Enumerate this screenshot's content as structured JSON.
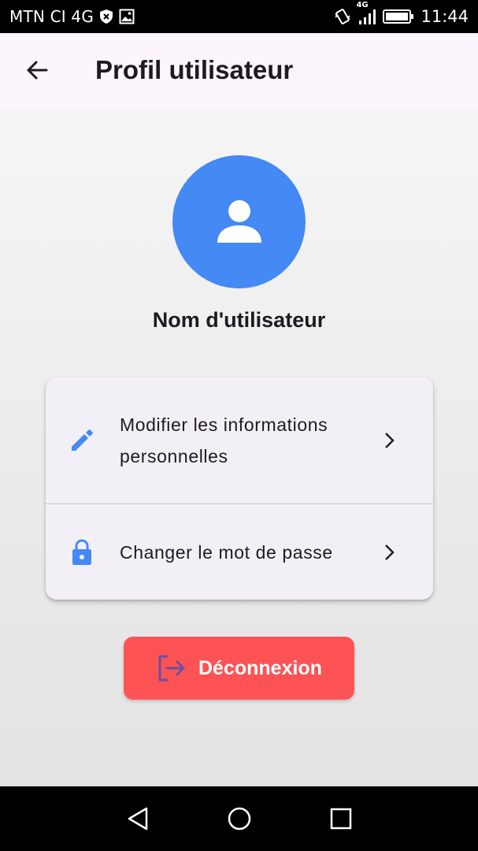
{
  "status_bar": {
    "carrier": "MTN CI 4G",
    "network_label": "4G",
    "time": "11:44",
    "icons": [
      "shield-x-icon",
      "image-icon",
      "vibrate-icon",
      "signal-icon",
      "battery-icon"
    ]
  },
  "app_bar": {
    "back_icon": "arrow-left-icon",
    "title": "Profil utilisateur"
  },
  "profile": {
    "avatar_icon": "person-icon",
    "username": "Nom d'utilisateur"
  },
  "menu": {
    "items": [
      {
        "icon": "pencil-icon",
        "label": "Modifier les informations personnelles",
        "trailing_icon": "chevron-right-icon"
      },
      {
        "icon": "lock-icon",
        "label": "Changer le mot de passe",
        "trailing_icon": "chevron-right-icon"
      }
    ]
  },
  "logout": {
    "icon": "logout-icon",
    "label": "Déconnexion"
  },
  "nav_bar": {
    "buttons": [
      "back-triangle-icon",
      "home-circle-icon",
      "recents-square-icon"
    ]
  },
  "colors": {
    "primary_blue": "#4489f4",
    "logout_red": "#fd5355",
    "logout_icon_purple": "#6750a4",
    "app_bar_bg": "#fcf5fd",
    "card_bg": "#f3eff6",
    "text_dark": "#1d1b20"
  }
}
